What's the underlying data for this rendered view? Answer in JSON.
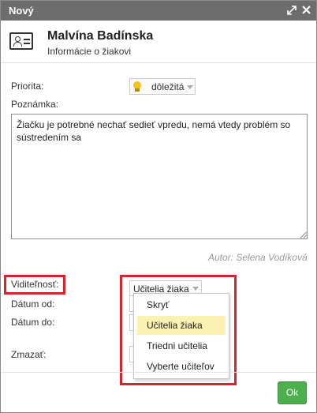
{
  "window": {
    "title": "Nový"
  },
  "header": {
    "name": "Malvína Badínska",
    "subtitle": "Informácie o žiakovi"
  },
  "form": {
    "priority_label": "Priorita:",
    "priority_value": "dôležitá",
    "note_label": "Poznámka:",
    "note_text": "Žiačku je potrebné nechať sedieť vpredu, nemá vtedy problém so sústredením sa",
    "author": "Autor: Selena Vodíková",
    "visibility_label": "Viditeľnosť:",
    "visibility_value": "Učitelia žiaka",
    "date_from_label": "Dátum od:",
    "date_to_label": "Dátum do:",
    "delete_label": "Zmazať:"
  },
  "dropdown": {
    "options": [
      "Skryť",
      "Učitelia žiaka",
      "Triedni učitelia",
      "Vyberte učiteľov"
    ],
    "selected": "Učitelia žiaka"
  },
  "footer": {
    "ok_label": "Ok"
  },
  "colors": {
    "titlebar": "#6d6d6d",
    "ok_button": "#4cae4c",
    "highlight": "#d9232a",
    "selected_option": "#fbf1b3"
  },
  "icons": {
    "expand": "expand-icon",
    "close": "close-icon",
    "student_card": "id-card-icon",
    "priority": "lightbulb-icon"
  }
}
